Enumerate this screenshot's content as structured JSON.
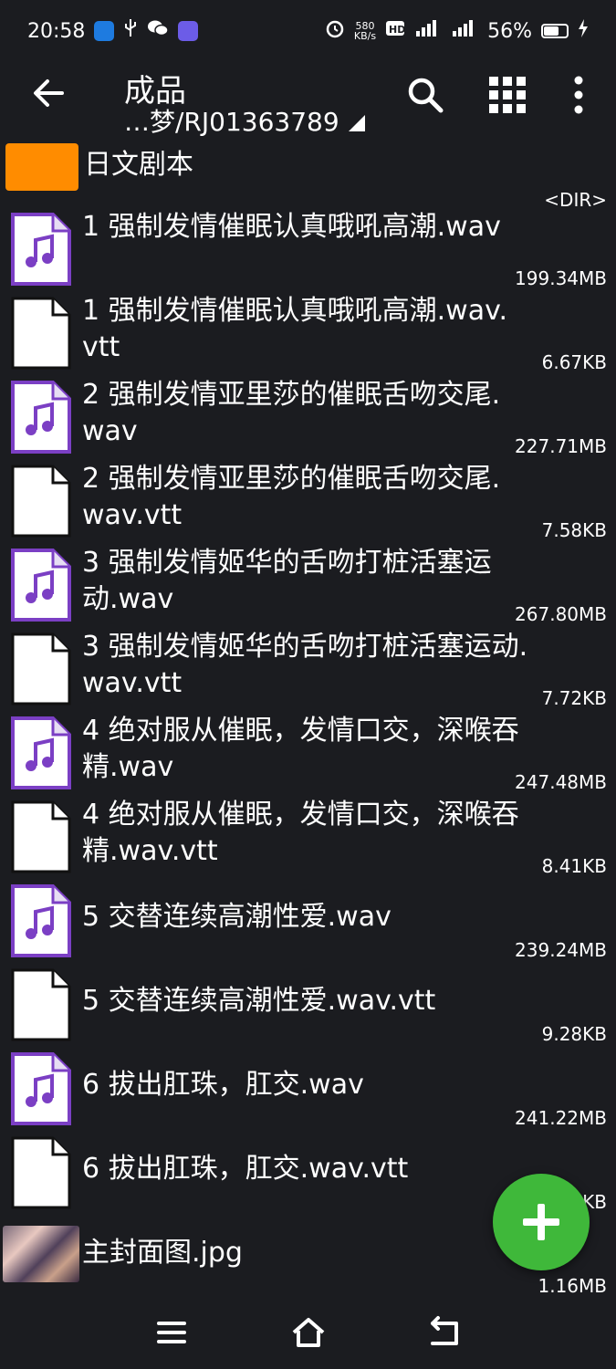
{
  "status_bar": {
    "time": "20:58",
    "network_speed_value": "580",
    "network_speed_unit": "KB/s",
    "battery": "56%",
    "icons_left": [
      "app-badge-icon",
      "usb-icon",
      "wechat-icon",
      "app-icon"
    ],
    "icons_right": [
      "alarm-icon",
      "hd-icon",
      "5g-signal-icon",
      "signal-icon",
      "battery-icon",
      "charging-icon"
    ]
  },
  "app_bar": {
    "title": "成品",
    "path": "…梦/RJ01363789",
    "actions": [
      "search-icon",
      "grid-view-icon",
      "more-vert-icon"
    ]
  },
  "files": [
    {
      "name": "日文剧本",
      "size": "<DIR>",
      "kind": "folder"
    },
    {
      "name": "1 强制发情催眠认真哦吼高潮.wav",
      "size": "199.34MB",
      "kind": "audio"
    },
    {
      "name": "1 强制发情催眠认真哦吼高潮.wav.vtt",
      "size": "6.67KB",
      "kind": "file"
    },
    {
      "name": "2 强制发情亚里莎的催眠舌吻交尾.wav",
      "size": "227.71MB",
      "kind": "audio"
    },
    {
      "name": "2 强制发情亚里莎的催眠舌吻交尾.wav.vtt",
      "size": "7.58KB",
      "kind": "file"
    },
    {
      "name": "3 强制发情姬华的舌吻打桩活塞运动.wav",
      "size": "267.80MB",
      "kind": "audio"
    },
    {
      "name": "3 强制发情姬华的舌吻打桩活塞运动.wav.vtt",
      "size": "7.72KB",
      "kind": "file"
    },
    {
      "name": "4 绝对服从催眠，发情口交，深喉吞精.wav",
      "size": "247.48MB",
      "kind": "audio"
    },
    {
      "name": "4 绝对服从催眠，发情口交，深喉吞精.wav.vtt",
      "size": "8.41KB",
      "kind": "file"
    },
    {
      "name": "5 交替连续高潮性爱.wav",
      "size": "239.24MB",
      "kind": "audio"
    },
    {
      "name": "5 交替连续高潮性爱.wav.vtt",
      "size": "9.28KB",
      "kind": "file"
    },
    {
      "name": "6 拔出肛珠，肛交.wav",
      "size": "241.22MB",
      "kind": "audio"
    },
    {
      "name": "6 拔出肛珠，肛交.wav.vtt",
      "size": "KB",
      "kind": "file"
    },
    {
      "name": "主封面图.jpg",
      "size": "1.16MB",
      "kind": "image"
    }
  ],
  "fab": {
    "icon": "add-icon",
    "color": "#3fb83a"
  },
  "nav_bar": {
    "buttons": [
      "menu-icon",
      "home-icon",
      "back-icon"
    ]
  },
  "colors": {
    "background": "#1b1c20",
    "folder": "#ff8c00",
    "audio_icon": "#7b3fc4",
    "fab": "#3fb83a"
  }
}
